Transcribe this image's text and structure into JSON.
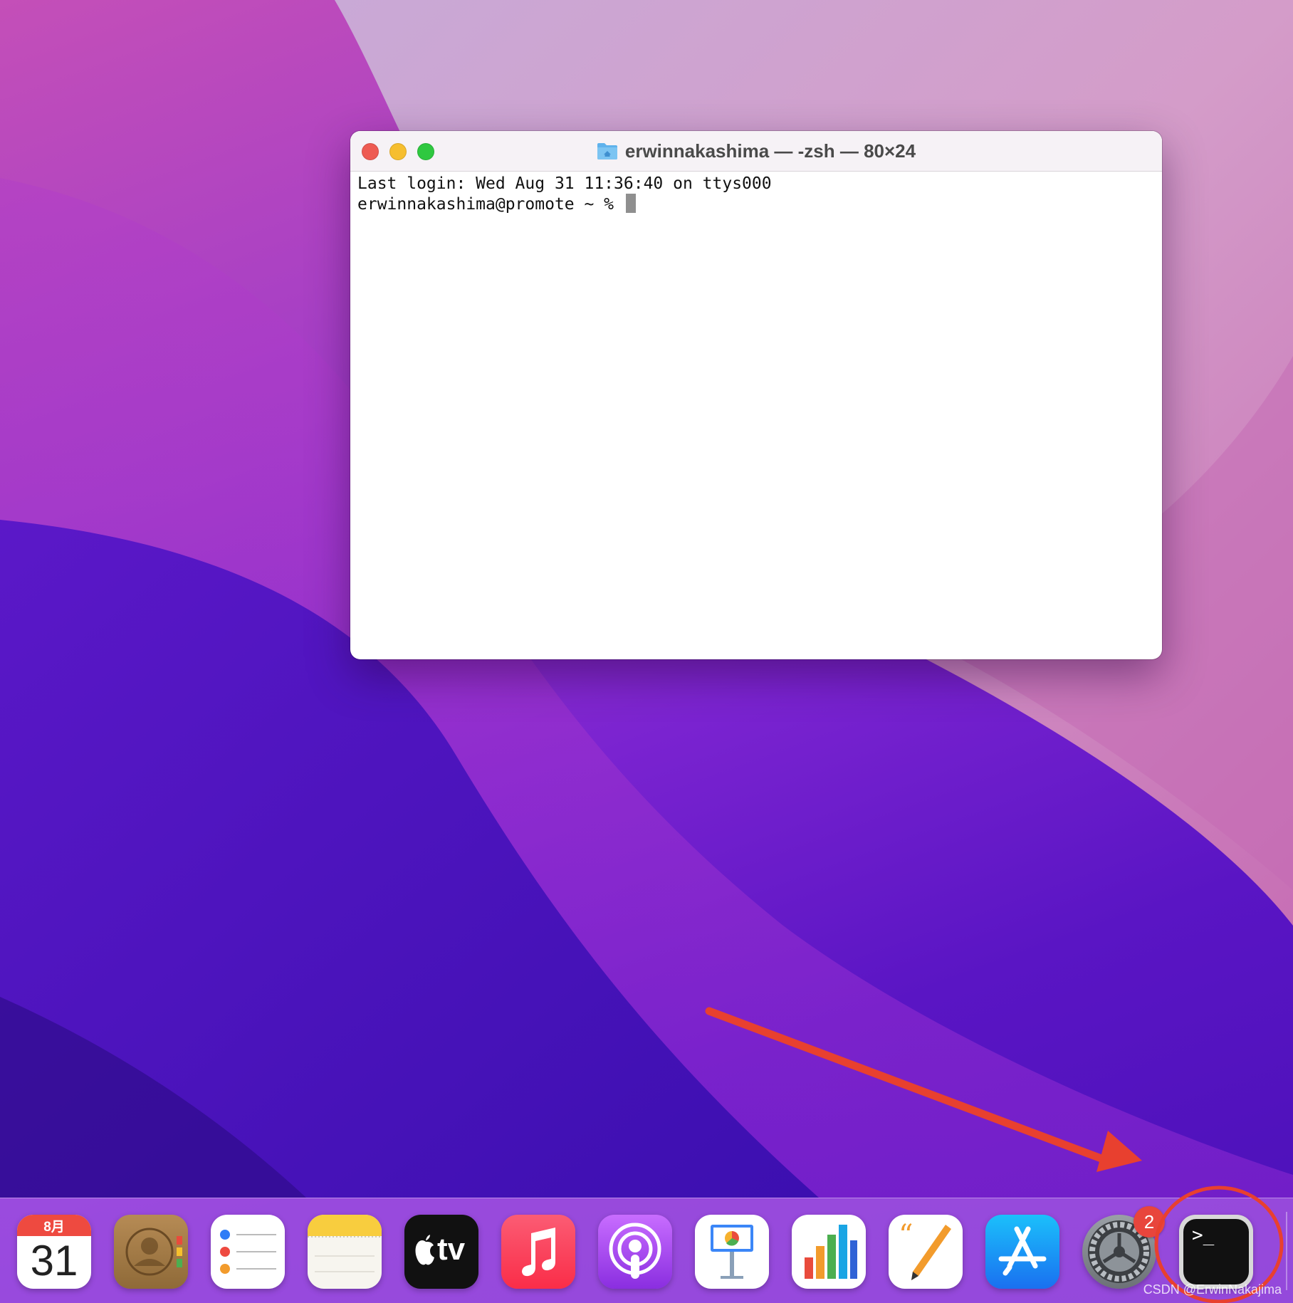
{
  "window": {
    "title": "erwinnakashima — -zsh — 80×24",
    "lines": [
      "Last login: Wed Aug 31 11:36:40 on ttys000",
      "erwinnakashima@promote ~ % "
    ]
  },
  "dock": {
    "calendar": {
      "month": "8月",
      "day": "31"
    },
    "appletv_label": "tv",
    "terminal_prompt": ">_",
    "settings_badge": "2",
    "apps": [
      "calendar-app-icon",
      "contacts-app-icon",
      "reminders-app-icon",
      "notes-app-icon",
      "appletv-app-icon",
      "music-app-icon",
      "podcasts-app-icon",
      "keynote-app-icon",
      "numbers-app-icon",
      "pages-app-icon",
      "appstore-app-icon",
      "system-preferences-app-icon",
      "terminal-app-icon"
    ]
  },
  "annotation": {
    "color": "#e8402f"
  },
  "watermark": "CSDN @ErwinNakajima"
}
